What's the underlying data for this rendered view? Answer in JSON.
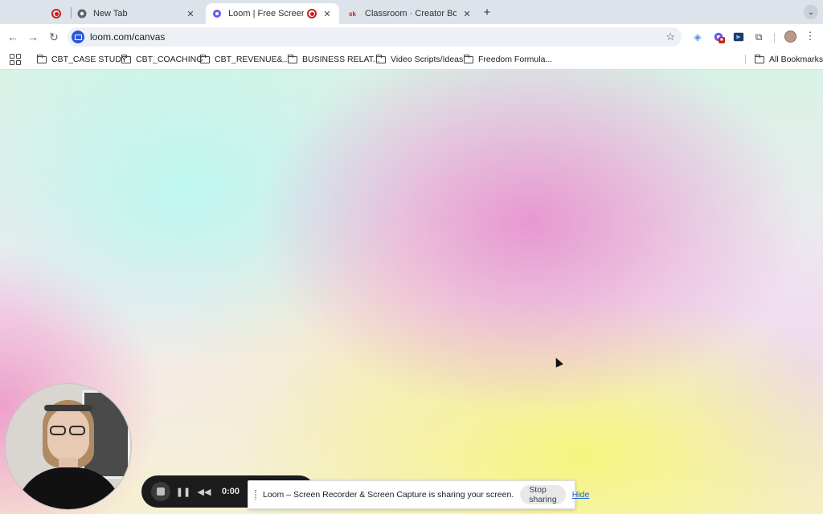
{
  "tabs": [
    {
      "title": "",
      "favicon": "recording-icon",
      "active": false
    },
    {
      "title": "New Tab",
      "favicon": "chrome-icon",
      "active": false
    },
    {
      "title": "Loom | Free Screen & Vide",
      "favicon": "loom-icon",
      "active": true,
      "recording": true
    },
    {
      "title": "Classroom · Creator Boost Tr",
      "favicon": "sk-icon",
      "favicon_text": "sk",
      "active": false
    }
  ],
  "toolbar": {
    "url": "loom.com/canvas"
  },
  "bookmarks": {
    "items": [
      {
        "label": "CBT_CASE STUDY"
      },
      {
        "label": "CBT_COACHING"
      },
      {
        "label": "CBT_REVENUE&..."
      },
      {
        "label": "BUSINESS RELAT..."
      },
      {
        "label": "Video Scripts/Ideas"
      },
      {
        "label": "Freedom Formula..."
      }
    ],
    "all_label": "All Bookmarks"
  },
  "recorder": {
    "time": "0:00"
  },
  "share_bar": {
    "message": "Loom – Screen Recorder & Screen Capture is sharing your screen.",
    "stop_label": "Stop sharing",
    "hide_label": "Hide"
  },
  "colors": {
    "tabstrip": "#dde3ea",
    "accent": "#1a5fd6",
    "recording": "#c5221f",
    "loom": "#625df5"
  }
}
